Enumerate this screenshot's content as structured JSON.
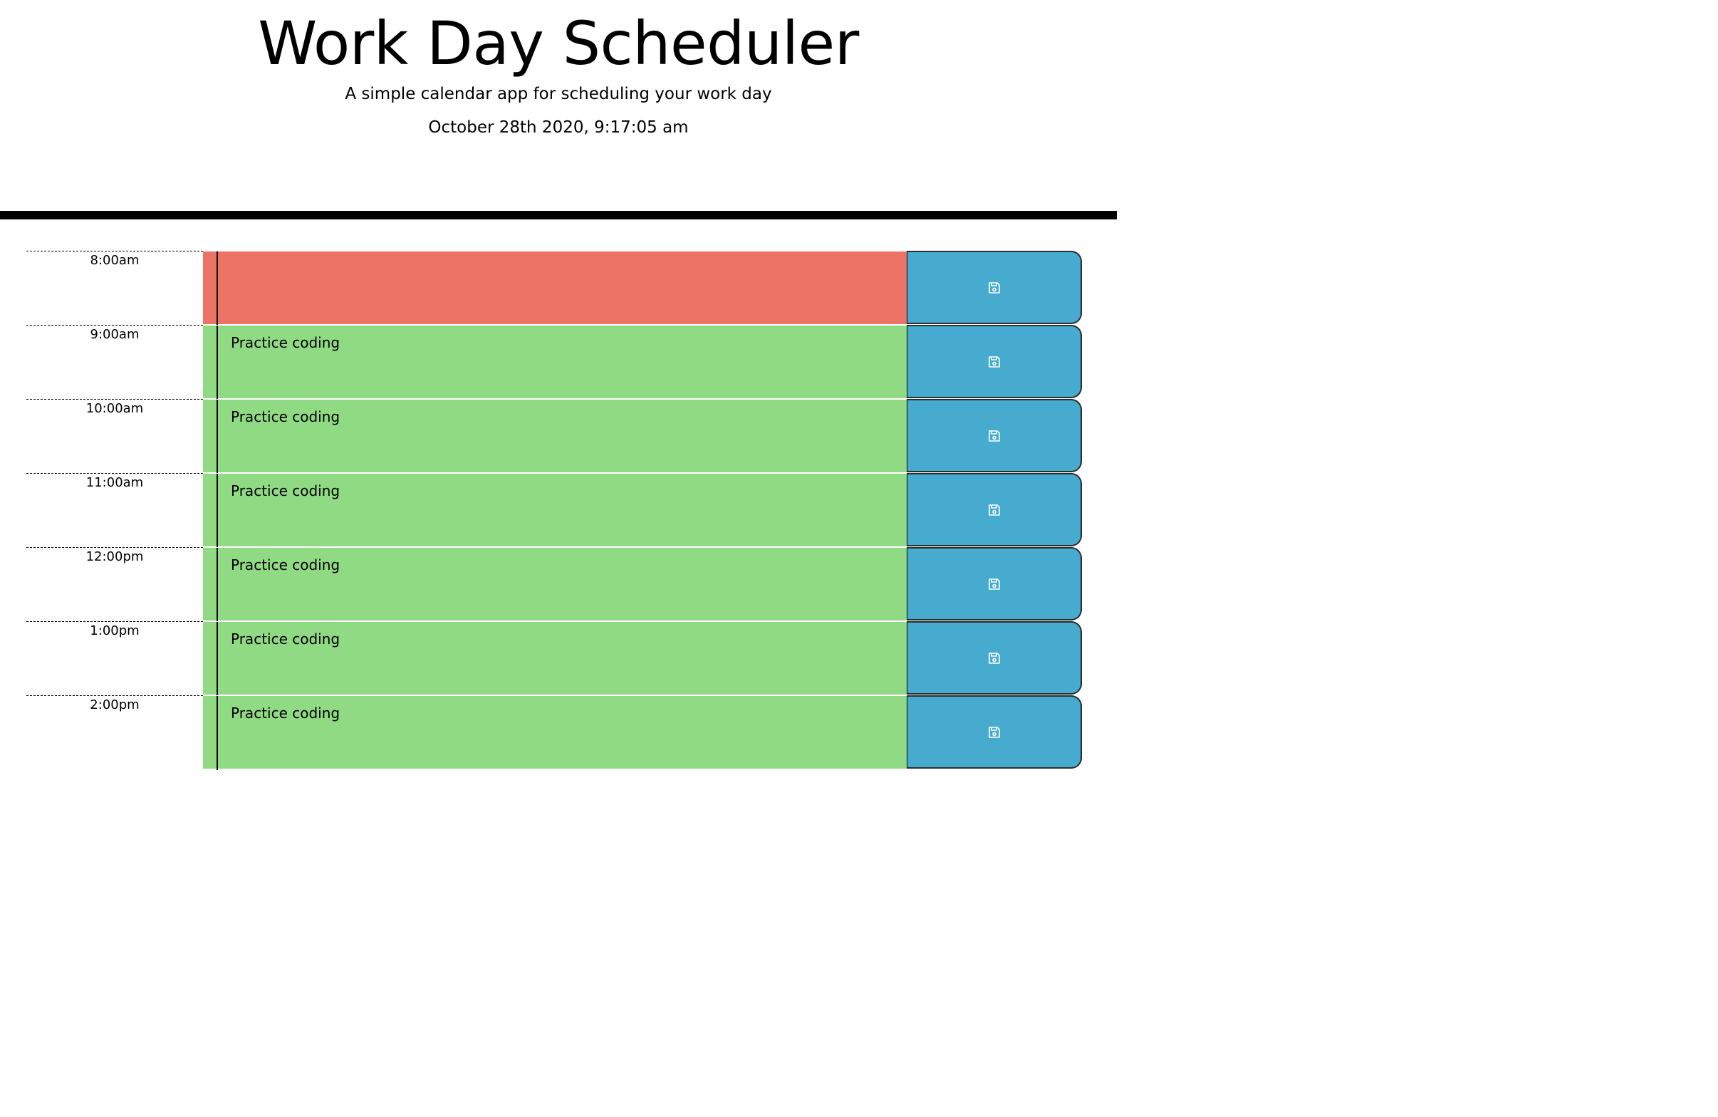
{
  "header": {
    "title": "Work Day Scheduler",
    "lead": "A simple calendar app for scheduling your work day",
    "current_day": "October 28th 2020, 9:17:05 am"
  },
  "colors": {
    "past": "#ee7367",
    "future": "#90da84",
    "save_button": "#47abd0"
  },
  "save_icon": "save-icon",
  "time_blocks": [
    {
      "hour": "8:00am",
      "text": "",
      "state": "past"
    },
    {
      "hour": "9:00am",
      "text": "Practice coding",
      "state": "future"
    },
    {
      "hour": "10:00am",
      "text": "Practice coding",
      "state": "future"
    },
    {
      "hour": "11:00am",
      "text": "Practice coding",
      "state": "future"
    },
    {
      "hour": "12:00pm",
      "text": "Practice coding",
      "state": "future"
    },
    {
      "hour": "1:00pm",
      "text": "Practice coding",
      "state": "future"
    },
    {
      "hour": "2:00pm",
      "text": "Practice coding",
      "state": "future"
    }
  ]
}
